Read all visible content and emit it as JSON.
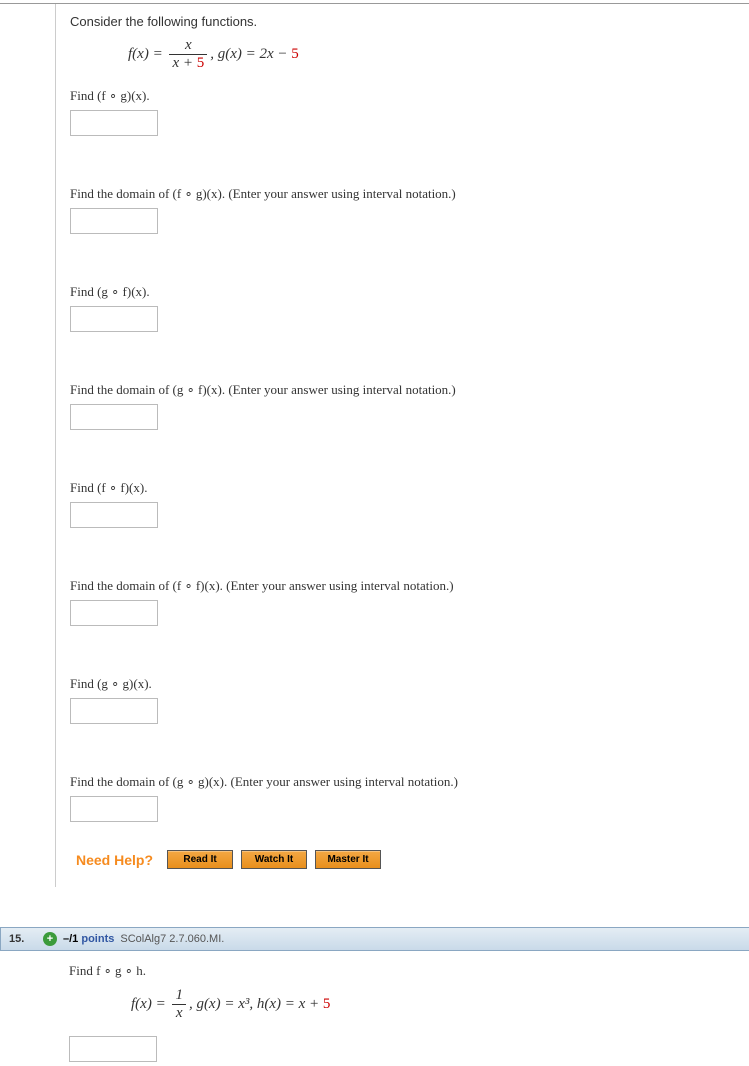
{
  "q14": {
    "prompt": "Consider the following functions.",
    "fx_lhs": "f(x) = ",
    "fx_num": "x",
    "fx_den_a": "x + ",
    "fx_den_const": "5",
    "gx_a": ",    g(x) = 2x − ",
    "gx_const": "5",
    "sub1": "Find  (f ∘ g)(x).",
    "sub2": "Find the domain of  (f ∘ g)(x). (Enter your answer using interval notation.)",
    "sub3": "Find  (g ∘ f)(x).",
    "sub4": "Find the domain of  (g ∘ f)(x). (Enter your answer using interval notation.)",
    "sub5": "Find  (f ∘ f)(x).",
    "sub6": "Find the domain of  (f ∘ f)(x). (Enter your answer using interval notation.)",
    "sub7": "Find  (g ∘ g)(x).",
    "sub8": "Find the domain of  (g ∘ g)(x). (Enter your answer using interval notation.)",
    "need_help": "Need Help?",
    "read_it": "Read It",
    "watch_it": "Watch It",
    "master_it": "Master It"
  },
  "q15": {
    "number": "15.",
    "points_prefix": "–/1",
    "points_word": " points",
    "ref": "SColAlg7 2.7.060.MI.",
    "find": "Find  f ∘ g ∘ h.",
    "fx_lhs": "f(x) = ",
    "fx_num": "1",
    "fx_den": "x",
    "gx": ",   g(x) = x³,   h(x) = x + ",
    "hx_const": "5"
  }
}
